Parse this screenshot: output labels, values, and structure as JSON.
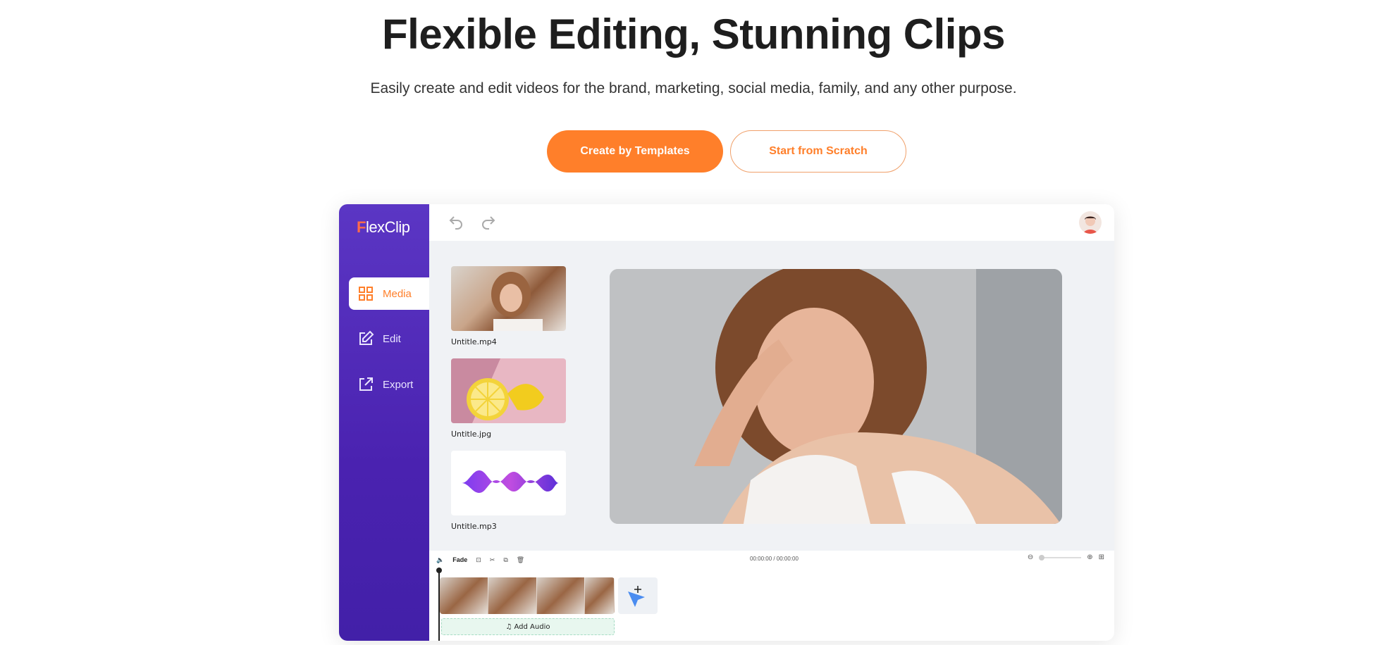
{
  "hero": {
    "title": "Flexible Editing, Stunning Clips",
    "subtitle": "Easily create and edit videos for the brand, marketing, social media, family, and any other purpose.",
    "primary_button": "Create by Templates",
    "secondary_button": "Start from Scratch"
  },
  "app": {
    "logo_first": "F",
    "logo_rest": "lexClip",
    "nav": [
      {
        "label": "Media",
        "icon": "grid-icon",
        "active": true
      },
      {
        "label": "Edit",
        "icon": "edit-icon",
        "active": false
      },
      {
        "label": "Export",
        "icon": "export-icon",
        "active": false
      }
    ],
    "media": [
      {
        "label": "Untitle.mp4",
        "type": "video"
      },
      {
        "label": "Untitle.jpg",
        "type": "image"
      },
      {
        "label": "Untitle.mp3",
        "type": "audio"
      }
    ],
    "timeline": {
      "fade_label": "Fade",
      "time": "00:00:00 / 00:00:00",
      "add_audio": "Add Audio"
    }
  },
  "colors": {
    "accent": "#ff7f2a",
    "sidebar": "#4a22b0"
  }
}
